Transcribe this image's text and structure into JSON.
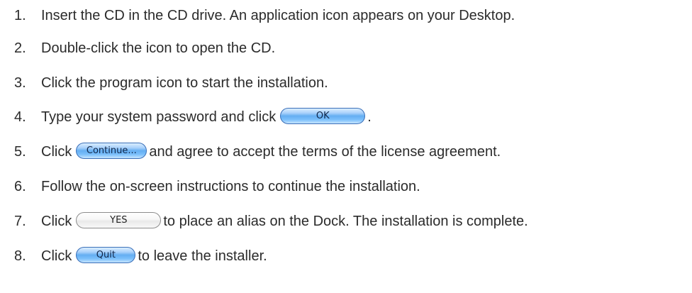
{
  "steps": [
    {
      "number": "1.",
      "text": "Insert the CD in the CD drive. An application icon appears on your Desktop."
    },
    {
      "number": "2.",
      "text": "Double-click the icon to open the CD."
    },
    {
      "number": "3.",
      "text": "Click the program icon to start the installation."
    },
    {
      "number": "4.",
      "before": "Type your system password and click",
      "button": "OK",
      "after": "."
    },
    {
      "number": "5.",
      "before": "Click",
      "button": "Continue...",
      "after": "and agree to accept the terms of the license agreement."
    },
    {
      "number": "6.",
      "text": "Follow the on-screen instructions to continue the installation."
    },
    {
      "number": "7.",
      "before": "Click",
      "button": "YES",
      "after": "to place an alias on the Dock. The installation is complete."
    },
    {
      "number": "8.",
      "before": "Click",
      "button": "Quit",
      "after": "to leave the installer."
    }
  ],
  "colors": {
    "text": "#2b2b2b",
    "aqua_blue": "#64aef2",
    "aqua_border": "#3a6fb8"
  }
}
